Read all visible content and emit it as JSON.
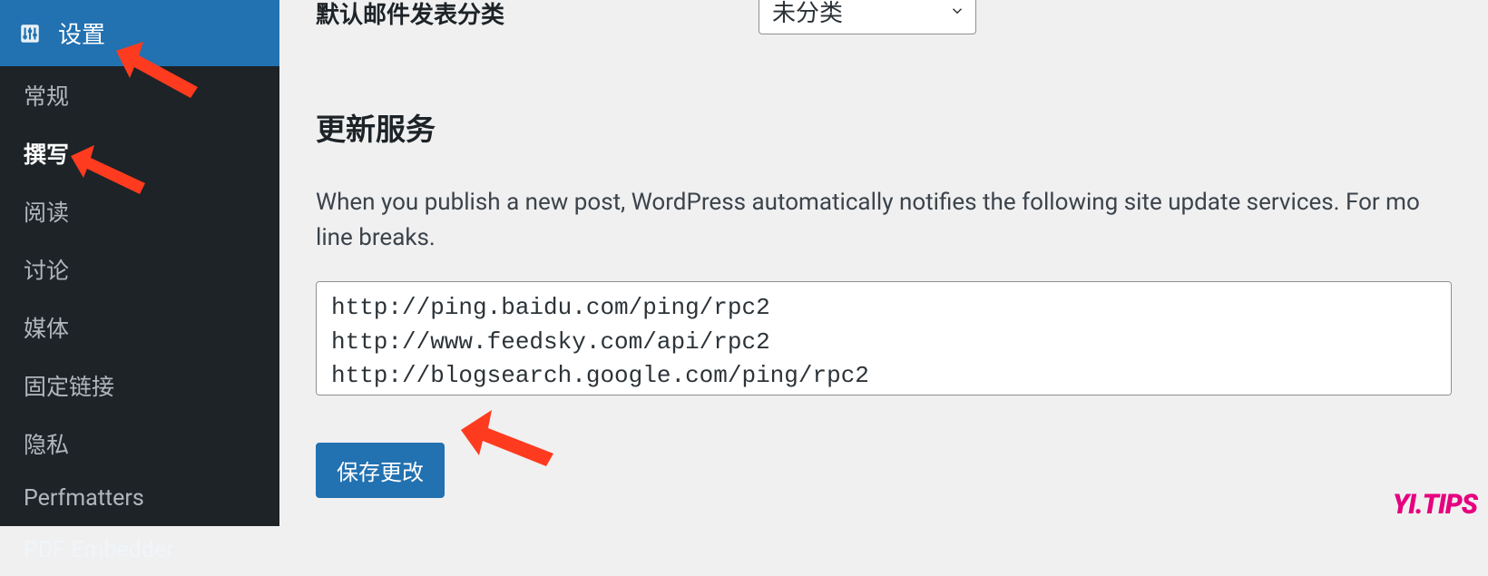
{
  "sidebar": {
    "header": {
      "label": "设置"
    },
    "items": [
      {
        "label": "常规"
      },
      {
        "label": "撰写",
        "active": true
      },
      {
        "label": "阅读"
      },
      {
        "label": "讨论"
      },
      {
        "label": "媒体"
      },
      {
        "label": "固定链接"
      },
      {
        "label": "隐私"
      },
      {
        "label": "Perfmatters"
      },
      {
        "label": "PDF Embedder"
      }
    ]
  },
  "main": {
    "default_category_label": "默认邮件发表分类",
    "default_category_value": "未分类",
    "section_title": "更新服务",
    "description": "When you publish a new post, WordPress automatically notifies the following site update services. For mo line breaks.",
    "ping_urls": "http://ping.baidu.com/ping/rpc2\nhttp://www.feedsky.com/api/rpc2\nhttp://blogsearch.google.com/ping/rpc2",
    "save_label": "保存更改"
  },
  "watermark": "YI.TIPS"
}
